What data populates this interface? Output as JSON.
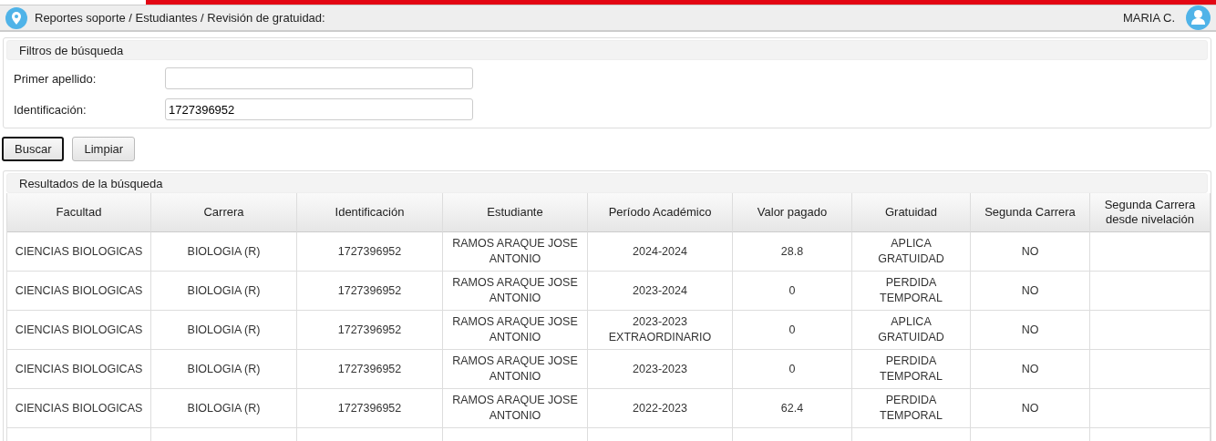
{
  "header": {
    "breadcrumb": "Reportes soporte / Estudiantes / Revisión de gratuidad:",
    "user": "MARIA C."
  },
  "filters": {
    "title": "Filtros de búsqueda",
    "fields": [
      {
        "label": "Primer apellido:"
      },
      {
        "label": "Identificación:",
        "value": "1727396952"
      }
    ]
  },
  "buttons": [
    {
      "label": "Buscar",
      "focused": true
    },
    {
      "label": "Limpiar",
      "focused": false
    }
  ],
  "results": {
    "title": "Resultados de la búsqueda",
    "columns": [
      "Facultad",
      "Carrera",
      "Identificación",
      "Estudiante",
      "Período Académico",
      "Valor pagado",
      "Gratuidad",
      "Segunda Carrera",
      "Segunda Carrera desde nivelación"
    ],
    "rows": [
      [
        "CIENCIAS BIOLOGICAS",
        "BIOLOGIA (R)",
        "1727396952",
        "RAMOS ARAQUE JOSE ANTONIO",
        "2024-2024",
        "28.8",
        "APLICA GRATUIDAD",
        "NO"
      ],
      [
        "CIENCIAS BIOLOGICAS",
        "BIOLOGIA (R)",
        "1727396952",
        "RAMOS ARAQUE JOSE ANTONIO",
        "2023-2024",
        "0",
        "PERDIDA TEMPORAL",
        "NO"
      ],
      [
        "CIENCIAS BIOLOGICAS",
        "BIOLOGIA (R)",
        "1727396952",
        "RAMOS ARAQUE JOSE ANTONIO",
        "2023-2023 EXTRAORDINARIO",
        "0",
        "APLICA GRATUIDAD",
        "NO"
      ],
      [
        "CIENCIAS BIOLOGICAS",
        "BIOLOGIA (R)",
        "1727396952",
        "RAMOS ARAQUE JOSE ANTONIO",
        "2023-2023",
        "0",
        "PERDIDA TEMPORAL",
        "NO"
      ],
      [
        "CIENCIAS BIOLOGICAS",
        "BIOLOGIA (R)",
        "1727396952",
        "RAMOS ARAQUE JOSE ANTONIO",
        "2022-2023",
        "62.4",
        "PERDIDA TEMPORAL",
        "NO"
      ]
    ]
  }
}
